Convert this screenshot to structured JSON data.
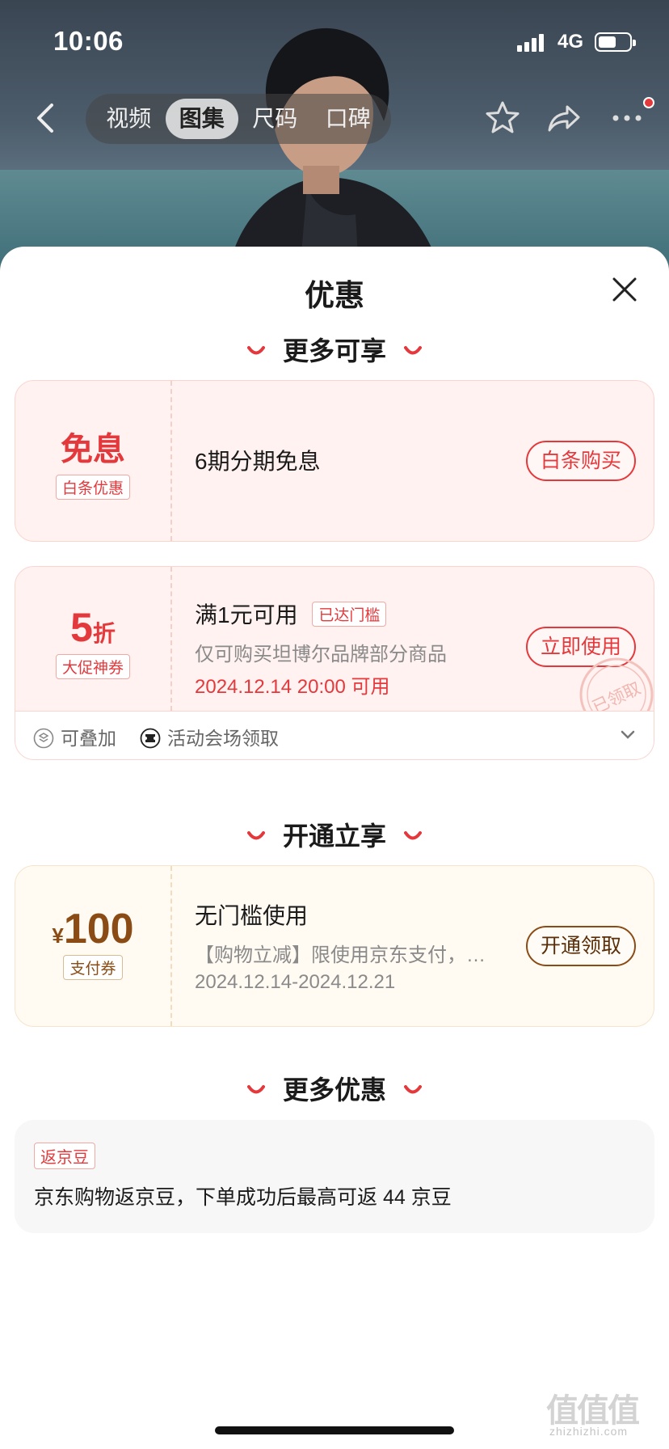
{
  "status_bar": {
    "time": "10:06",
    "network": "4G"
  },
  "nav": {
    "tabs": [
      "视频",
      "图集",
      "尺码",
      "口碑"
    ],
    "active_tab": "图集"
  },
  "sheet": {
    "title": "优惠",
    "sections": {
      "s1": "更多可享",
      "s2": "开通立享",
      "s3": "更多优惠"
    },
    "card_interest_free": {
      "big": "免息",
      "tag": "白条优惠",
      "text": "6期分期免息",
      "button": "白条购买"
    },
    "card_discount": {
      "num": "5",
      "unit": "折",
      "tag": "大促神券",
      "title": "满1元可用",
      "badge": "已达门槛",
      "desc": "仅可购买坦博尔品牌部分商品",
      "time": "2024.12.14 20:00 可用",
      "button": "立即使用",
      "stamp": "已领取",
      "footer": {
        "stackable": "可叠加",
        "source": "活动会场领取"
      }
    },
    "card_pay": {
      "currency": "¥",
      "amount": "100",
      "tag": "支付券",
      "title": "无门槛使用",
      "desc": "【购物立减】限使用京东支付，…",
      "period": "2024.12.14-2024.12.21",
      "button": "开通领取"
    },
    "more": {
      "tag": "返京豆",
      "text": "京东购物返京豆，下单成功后最高可返 44 京豆"
    }
  },
  "watermark": {
    "text": "值值值",
    "url": "zhizhizhi.com"
  },
  "colors": {
    "accent": "#e4393c",
    "brown": "#8a4c14"
  }
}
